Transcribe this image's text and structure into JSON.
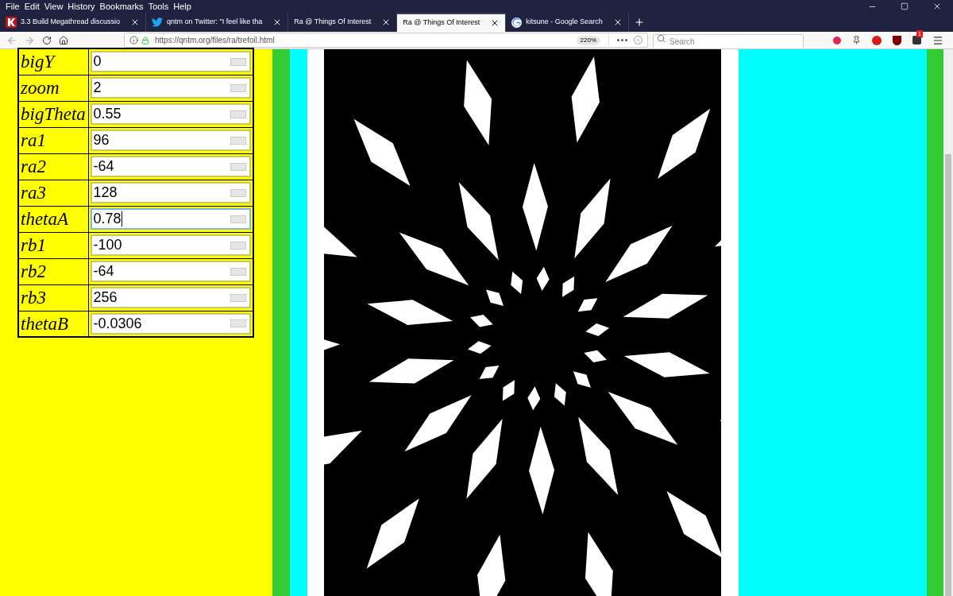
{
  "menu": [
    "File",
    "Edit",
    "View",
    "History",
    "Bookmarks",
    "Tools",
    "Help"
  ],
  "tabs": [
    {
      "title": "3.3 Build Megathread discussio",
      "selected": false
    },
    {
      "title": "qntm on Twitter: \"I feel like tha",
      "selected": false
    },
    {
      "title": "Ra @ Things Of Interest",
      "selected": false
    },
    {
      "title": "Ra @ Things Of Interest",
      "selected": true
    },
    {
      "title": "kitsune - Google Search",
      "selected": false
    }
  ],
  "address": {
    "url": "https://qntm.org/files/ra/trefoil.html",
    "zoom": "220%"
  },
  "search": {
    "placeholder": "Search"
  },
  "extension_badge": "1",
  "params": [
    {
      "name": "bigY",
      "value": "0",
      "focused": false
    },
    {
      "name": "zoom",
      "value": "2",
      "focused": false
    },
    {
      "name": "bigTheta",
      "value": "0.55",
      "focused": false
    },
    {
      "name": "ra1",
      "value": "96",
      "focused": false
    },
    {
      "name": "ra2",
      "value": "-64",
      "focused": false
    },
    {
      "name": "ra3",
      "value": "128",
      "focused": false
    },
    {
      "name": "thetaA",
      "value": "0.78",
      "focused": true
    },
    {
      "name": "rb1",
      "value": "-100",
      "focused": false
    },
    {
      "name": "rb2",
      "value": "-64",
      "focused": false
    },
    {
      "name": "rb3",
      "value": "256",
      "focused": false
    },
    {
      "name": "thetaB",
      "value": "-0.0306",
      "focused": false
    }
  ]
}
